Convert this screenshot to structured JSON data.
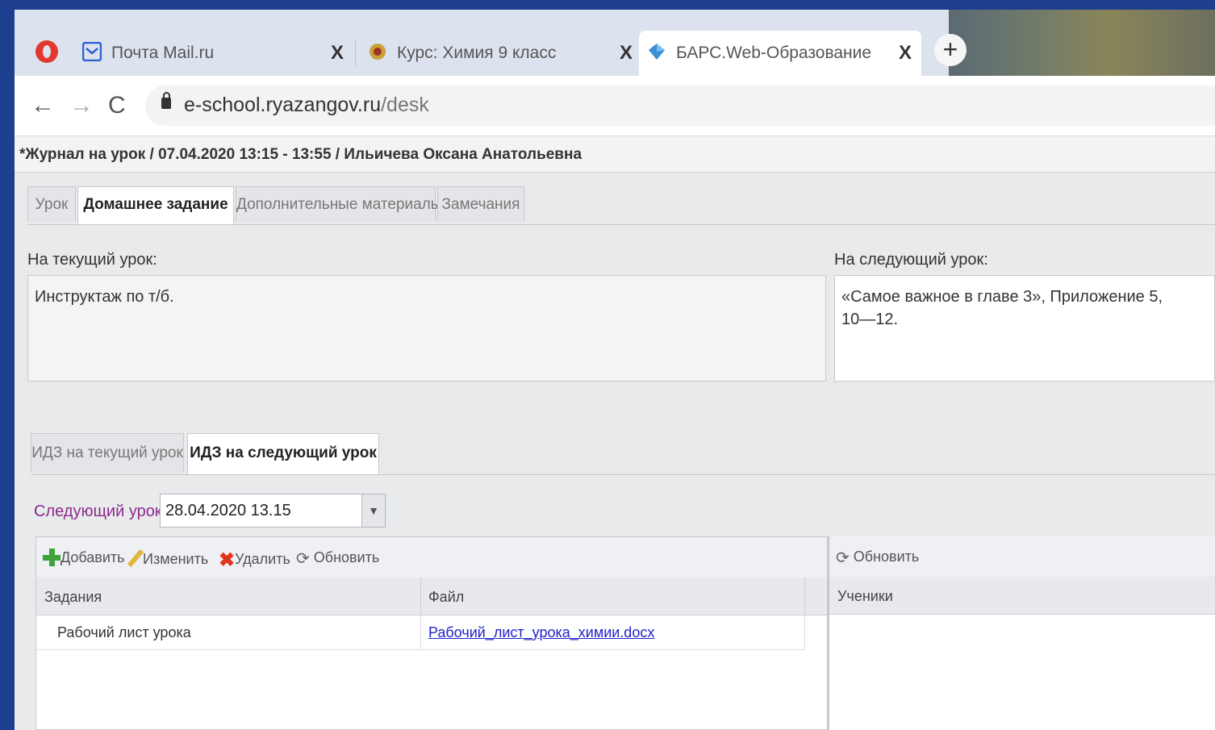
{
  "browser": {
    "tabs": [
      {
        "title": "Почта Mail.ru",
        "close": "X"
      },
      {
        "title": "Курс: Химия 9 класс",
        "close": "X"
      },
      {
        "title": "БАРС.Web-Образование",
        "close": "X"
      }
    ],
    "new_tab": "+",
    "url_domain": "e-school.ryazangov.ru",
    "url_path": "/desk",
    "nav": {
      "back": "←",
      "forward": "→",
      "reload": "C"
    }
  },
  "app": {
    "title": "*Журнал на урок / 07.04.2020 13:15 - 13:55 / Ильичева Оксана Анатольевна",
    "tabs": [
      "Урок",
      "Домашнее задание",
      "Дополнительные материалы",
      "Замечания"
    ],
    "current_label": "На текущий урок:",
    "current_text": "Инструктаж по т/б.",
    "next_label": "На следующий урок:",
    "next_text_line1": "«Самое важное в главе 3», Приложение 5,",
    "next_text_line2": "10—12.",
    "idz_tabs": [
      "ИДЗ на текущий урок",
      "ИДЗ на следующий урок"
    ],
    "next_lesson_label": "Следующий урок:",
    "next_lesson_value": "28.04.2020 13.15",
    "toolbar": {
      "add": "Добавить",
      "edit": "Изменить",
      "delete": "Удалить",
      "refresh": "Обновить"
    },
    "right_toolbar": {
      "refresh": "Обновить"
    },
    "columns": {
      "tasks": "Задания",
      "file": "Файл",
      "students": "Ученики"
    },
    "rows": [
      {
        "task": "Рабочий лист урока",
        "file": "Рабочий_лист_урока_химии.docx"
      }
    ]
  },
  "colors": {
    "frame": "#1e3f8f",
    "link": "#2222cc",
    "accent_label": "#8b2a8b"
  }
}
